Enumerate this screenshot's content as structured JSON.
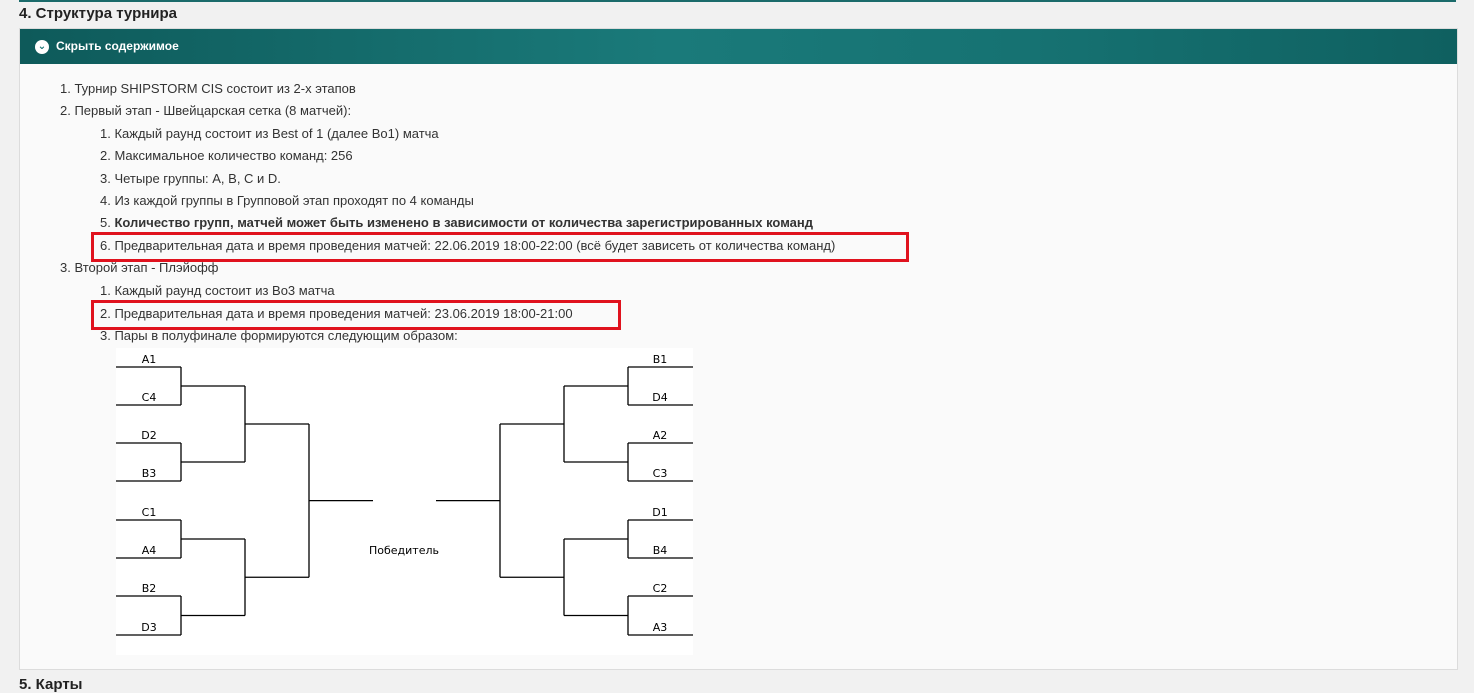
{
  "section_title": "4. Структура турнира",
  "spoiler": {
    "label": "Скрыть содержимое",
    "icon": "chevron-down-circle-icon"
  },
  "lines": [
    "1. Турнир SHIPSTORM CIS состоит из 2-х этапов",
    "2. Первый этап - Швейцарская сетка (8 матчей):",
    "1. Каждый раунд состоит из Best of 1 (далее Bo1) матча",
    "2. Максимальное количество команд: 256",
    "3. Четыре группы: A, B, C и D.",
    "4. Из каждой группы в Групповой этап проходят по 4 команды",
    "5. ",
    "Количество групп, матчей может быть изменено в зависимости от количества зарегистрированных команд",
    "6. Предварительная дата и время проведения матчей: 22.06.2019 18:00-22:00 (всё будет зависеть от количества команд)",
    "3. Второй этап - Плэйофф",
    "1. Каждый раунд состоит из Bo3 матча",
    "2. Предварительная дата и время проведения матчей: 23.06.2019 18:00-21:00",
    "3. Пары в полуфинале формируются следующим образом:"
  ],
  "bracket": {
    "left_teams": [
      "A1",
      "C4",
      "D2",
      "B3",
      "C1",
      "A4",
      "B2",
      "D3"
    ],
    "right_teams": [
      "B1",
      "D4",
      "A2",
      "C3",
      "D1",
      "B4",
      "C2",
      "A3"
    ],
    "winner_label": "Победитель"
  },
  "highlight_color": "#e0121e",
  "accent_color": "#167272",
  "next_section_title": "5. Карты"
}
